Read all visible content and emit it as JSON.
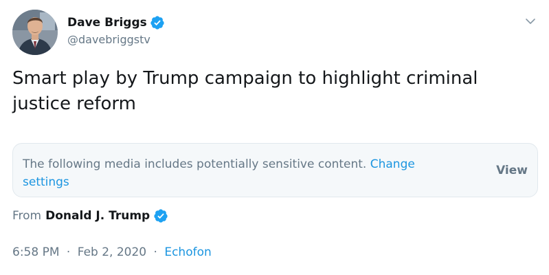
{
  "author": {
    "display_name": "Dave Briggs",
    "handle": "@davebriggstv",
    "verified": true
  },
  "tweet": {
    "text": "Smart play by Trump campaign to highlight criminal justice reform"
  },
  "sensitive_notice": {
    "message": "The following media includes potentially sensitive content.",
    "link_label": "Change settings",
    "view_label": "View"
  },
  "quoted_from": {
    "prefix": "From",
    "name": "Donald J. Trump",
    "verified": true
  },
  "meta": {
    "time": "6:58 PM",
    "separator": "·",
    "date": "Feb 2, 2020",
    "source": "Echofon"
  },
  "colors": {
    "accent": "#1b95e0",
    "verified_badge": "#1da1f2",
    "muted_text": "#657786",
    "primary_text": "#14171a",
    "notice_background": "#f5f8fa"
  },
  "icons": {
    "verified": "verified-badge-icon",
    "menu": "chevron-down-icon"
  }
}
